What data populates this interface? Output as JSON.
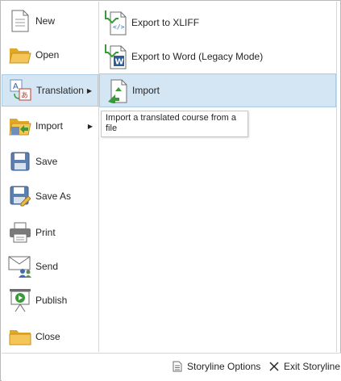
{
  "menu": {
    "items": [
      {
        "label": "New",
        "icon": "new-file-icon"
      },
      {
        "label": "Open",
        "icon": "open-folder-icon"
      },
      {
        "label": "Translation",
        "icon": "translation-icon",
        "has_submenu": true,
        "active": true
      },
      {
        "label": "Import",
        "icon": "import-icon",
        "has_submenu": true
      },
      {
        "label": "Save",
        "icon": "save-disk-icon"
      },
      {
        "label": "Save As",
        "icon": "save-as-icon"
      },
      {
        "label": "Print",
        "icon": "printer-icon"
      },
      {
        "label": "Send",
        "icon": "send-icon"
      },
      {
        "label": "Publish",
        "icon": "publish-icon"
      },
      {
        "label": "Close",
        "icon": "close-folder-icon"
      }
    ]
  },
  "submenu": {
    "items": [
      {
        "label": "Export to XLIFF",
        "icon": "xliff-export-icon"
      },
      {
        "label": "Export to Word (Legacy Mode)",
        "icon": "word-export-icon"
      },
      {
        "label": "Import",
        "icon": "import-translation-icon",
        "active": true
      }
    ],
    "tooltip": "Import a translated course from a file"
  },
  "footer": {
    "options_label": "Storyline Options",
    "exit_label": "Exit Storyline"
  },
  "colors": {
    "highlight": "#d4e6f4",
    "highlight_border": "#a9cde9",
    "accent_green": "#3a9a3a"
  }
}
